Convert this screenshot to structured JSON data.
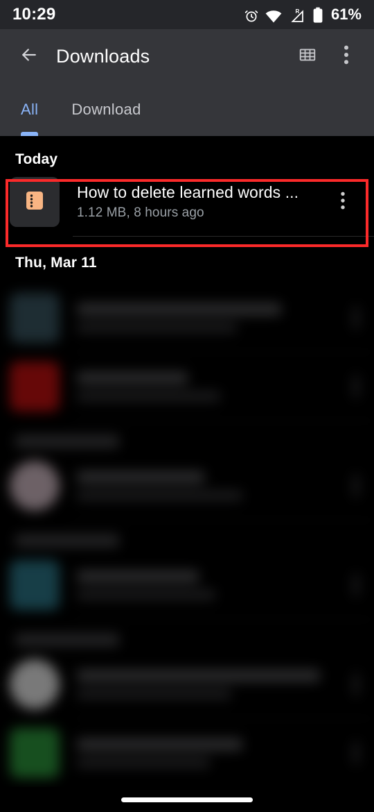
{
  "status_bar": {
    "time": "10:29",
    "battery_percent": "61%",
    "icons": [
      "alarm-icon",
      "wifi-icon",
      "cellular-signal-roaming-icon",
      "battery-icon"
    ]
  },
  "app_bar": {
    "back_icon": "back-arrow-icon",
    "title": "Downloads",
    "grid_view_icon": "grid-view-icon",
    "overflow_icon": "more-vert-icon"
  },
  "tabs": [
    {
      "label": "All",
      "selected": true
    },
    {
      "label": "Download",
      "selected": false
    }
  ],
  "sections": [
    {
      "header": "Today",
      "items": [
        {
          "title": "How to delete learned words ...",
          "subtitle": "1.12 MB, 8 hours ago",
          "icon": "video-file-icon",
          "icon_color": "#f8b583",
          "highlighted": true,
          "menu_icon": "more-vert-icon"
        }
      ]
    },
    {
      "header": "Thu, Mar 11",
      "items": [
        {
          "title": "",
          "subtitle": "",
          "icon": "file-icon",
          "icon_color": "#3c5a66",
          "blurred": true
        },
        {
          "title": "",
          "subtitle": "",
          "icon": "file-icon",
          "icon_color": "#cc1111",
          "blurred": true
        },
        {
          "title": "",
          "subtitle": "",
          "icon": "file-icon",
          "icon_color": "#d9c2cc",
          "blurred": true
        },
        {
          "title": "",
          "subtitle": "",
          "icon": "file-icon",
          "icon_color": "#2e7c8e",
          "blurred": true
        },
        {
          "title": "",
          "subtitle": "",
          "icon": "file-icon",
          "icon_color": "#f2f2f2",
          "blurred": true
        },
        {
          "title": "",
          "subtitle": "",
          "icon": "file-icon",
          "icon_color": "#2f9e3f",
          "blurred": true
        }
      ]
    }
  ],
  "annotation": {
    "highlight_color": "#fb2a2a",
    "target": "How to delete learned words ..."
  },
  "theme": {
    "background": "#000000",
    "app_bar_background": "#35363a",
    "status_bar_background": "#25262a",
    "accent": "#8ab4f8",
    "secondary_text": "#9aa0a6"
  },
  "nav_bar": {
    "gesture_pill": "home-gesture-pill"
  }
}
